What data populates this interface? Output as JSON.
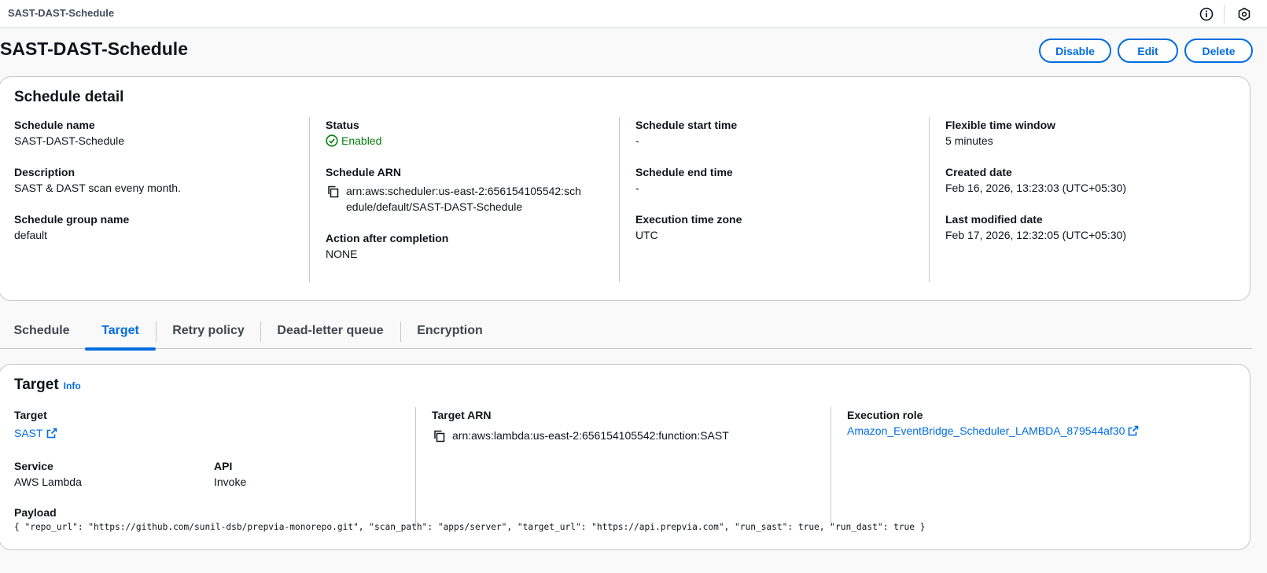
{
  "breadcrumb": "SAST-DAST-Schedule",
  "page_title": "SAST-DAST-Schedule",
  "actions": {
    "disable": "Disable",
    "edit": "Edit",
    "delete": "Delete"
  },
  "detail": {
    "title": "Schedule detail",
    "schedule_name_label": "Schedule name",
    "schedule_name": "SAST-DAST-Schedule",
    "description_label": "Description",
    "description": "SAST & DAST scan eveny month.",
    "group_label": "Schedule group name",
    "group": "default",
    "status_label": "Status",
    "status": "Enabled",
    "arn_label": "Schedule ARN",
    "arn": "arn:aws:scheduler:us-east-2:656154105542:schedule/default/SAST-DAST-Schedule",
    "action_label": "Action after completion",
    "action": "NONE",
    "start_label": "Schedule start time",
    "start": "-",
    "end_label": "Schedule end time",
    "end": "-",
    "tz_label": "Execution time zone",
    "tz": "UTC",
    "window_label": "Flexible time window",
    "window": "5 minutes",
    "created_label": "Created date",
    "created": "Feb 16, 2026, 13:23:03 (UTC+05:30)",
    "modified_label": "Last modified date",
    "modified": "Feb 17, 2026, 12:32:05 (UTC+05:30)"
  },
  "tabs": [
    "Schedule",
    "Target",
    "Retry policy",
    "Dead-letter queue",
    "Encryption"
  ],
  "active_tab": "Target",
  "target": {
    "title": "Target",
    "info": "Info",
    "target_label": "Target",
    "target": "SAST",
    "arn_label": "Target ARN",
    "arn": "arn:aws:lambda:us-east-2:656154105542:function:SAST",
    "role_label": "Execution role",
    "role": "Amazon_EventBridge_Scheduler_LAMBDA_879544af30",
    "service_label": "Service",
    "service": "AWS Lambda",
    "api_label": "API",
    "api": "Invoke",
    "payload_label": "Payload",
    "payload": "{ \"repo_url\": \"https://github.com/sunil-dsb/prepvia-monorepo.git\", \"scan_path\": \"apps/server\", \"target_url\": \"https://api.prepvia.com\", \"run_sast\": true, \"run_dast\": true }"
  },
  "colors": {
    "link": "#006ce0",
    "success": "#037f0c",
    "border": "#c6c6cd"
  },
  "icons": [
    "info-circle-icon",
    "settings-hex-icon",
    "check-circle-icon",
    "copy-icon",
    "external-link-icon"
  ]
}
